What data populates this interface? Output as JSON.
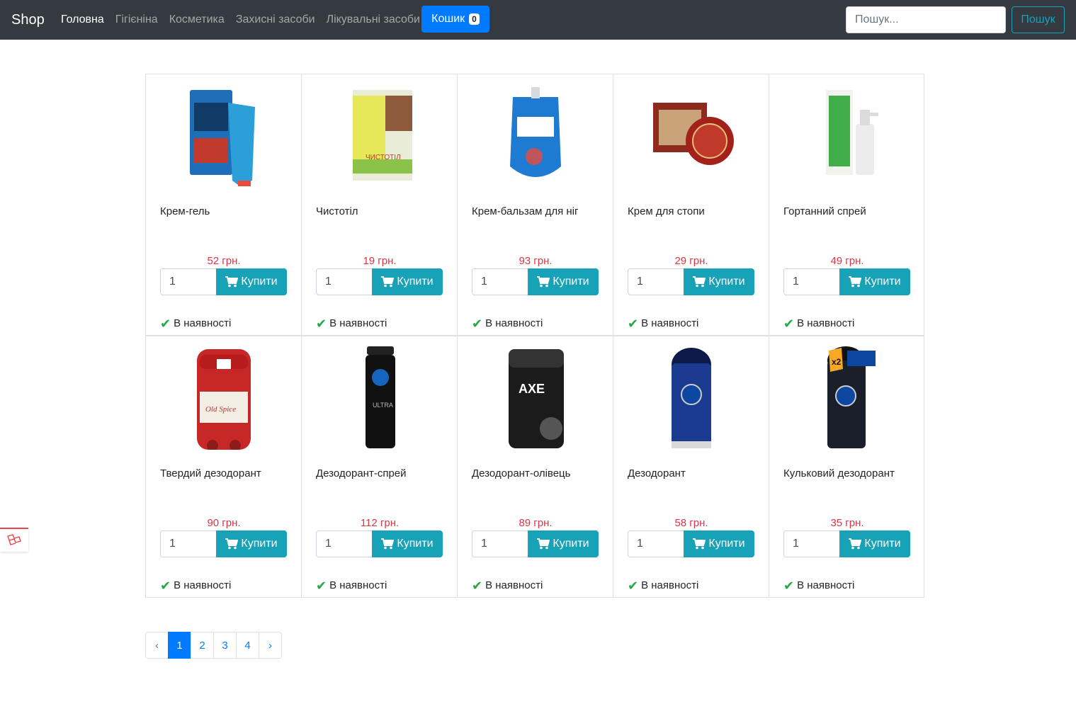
{
  "navbar": {
    "brand": "Shop",
    "links": [
      "Головна",
      "Гігієніна",
      "Косметика",
      "Захисні засоби",
      "Лікувальні засоби"
    ],
    "cart_label": "Кошик",
    "cart_count": "0",
    "search_placeholder": "Пошук...",
    "search_button": "Пошук"
  },
  "products": [
    {
      "name": "Крем-гель",
      "price": "52 грн.",
      "qty": "1",
      "buy": "Купити",
      "stock": "В наявності",
      "icon": "cream-tube-icon"
    },
    {
      "name": "Чистотіл",
      "price": "19 грн.",
      "qty": "1",
      "buy": "Купити",
      "stock": "В наявності",
      "icon": "elixir-package-icon"
    },
    {
      "name": "Крем-бальзам для ніг",
      "price": "93 грн.",
      "qty": "1",
      "buy": "Купити",
      "stock": "В наявності",
      "icon": "balm-pouch-icon"
    },
    {
      "name": "Крем для стопи",
      "price": "29 грн.",
      "qty": "1",
      "buy": "Купити",
      "stock": "В наявності",
      "icon": "cream-jar-icon"
    },
    {
      "name": "Гортанний спрей",
      "price": "49 грн.",
      "qty": "1",
      "buy": "Купити",
      "stock": "В наявності",
      "icon": "spray-bottle-icon"
    },
    {
      "name": "Твердий дезодорант",
      "price": "90 грн.",
      "qty": "1",
      "buy": "Купити",
      "stock": "В наявності",
      "icon": "stick-deodorant-icon"
    },
    {
      "name": "Дезодорант-спрей",
      "price": "112 грн.",
      "qty": "1",
      "buy": "Купити",
      "stock": "В наявності",
      "icon": "spray-can-icon"
    },
    {
      "name": "Дезодорант-олівець",
      "price": "89 грн.",
      "qty": "1",
      "buy": "Купити",
      "stock": "В наявності",
      "icon": "deodorant-pencil-icon"
    },
    {
      "name": "Дезодорант",
      "price": "58 грн.",
      "qty": "1",
      "buy": "Купити",
      "stock": "В наявності",
      "icon": "roll-on-icon"
    },
    {
      "name": "Кульковий дезодорант",
      "price": "35 грн.",
      "qty": "1",
      "buy": "Купити",
      "stock": "В наявності",
      "icon": "roll-on-double-icon"
    }
  ],
  "pagination": {
    "prev": "‹",
    "pages": [
      "1",
      "2",
      "3",
      "4"
    ],
    "next": "›",
    "active": "1"
  },
  "colors": {
    "navbar": "#343a40",
    "primary": "#007bff",
    "info": "#17a2b8",
    "price": "#dc3545",
    "success": "#28a745"
  }
}
